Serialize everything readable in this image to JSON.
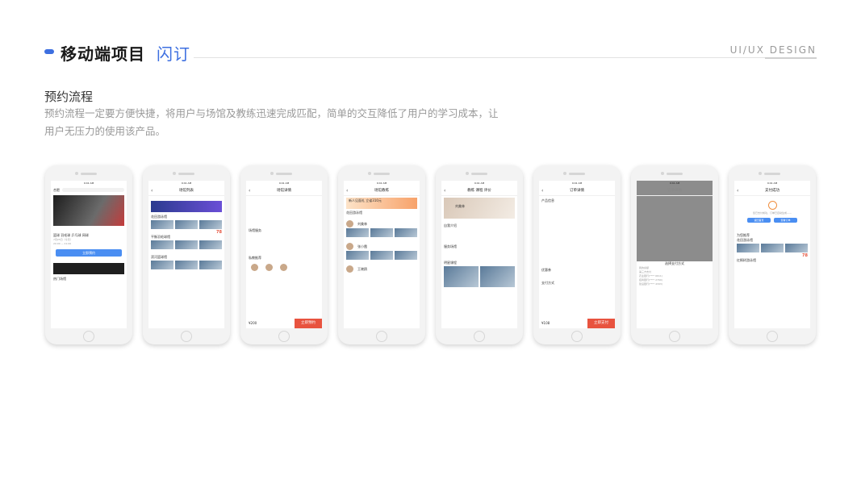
{
  "header": {
    "title": "移动端项目",
    "subtitle": "闪订",
    "brand": "UI/UX DESIGN"
  },
  "section": {
    "title": "预约流程",
    "description": "预约流程一定要方便快捷，将用户与场馆及教练迅速完成匹配，简单的交互降低了用户的学习成本，让用户无压力的使用该产品。"
  },
  "phones": {
    "p1": {
      "time": "9:41 AM",
      "city": "合肥",
      "tabs": "篮球 羽毛球 乒乓球 网球",
      "date": "7月25日（今天）",
      "time_range": "20:00 — 21:00",
      "book": "立即预约",
      "hot": "热门场馆"
    },
    "p2": {
      "nav": "场馆列表",
      "venue1": "花田游泳馆",
      "venue2": "平衡羽毛球馆",
      "venue3": "滨河篮球馆",
      "price": "78"
    },
    "p3": {
      "nav": "场馆详情",
      "service": "场馆服务",
      "coach": "私教推荐",
      "price": "¥200",
      "book": "立即预约"
    },
    "p4": {
      "nav": "场馆教练",
      "banner": "新人见面礼 立省310元",
      "venue": "花田游泳馆",
      "coach1": "刘美林",
      "coach2": "张小霞",
      "coach3": "王晓鸥"
    },
    "p5": {
      "tabs": "教练 课程 评价",
      "coach": "刘美林",
      "intro": "自我介绍",
      "service": "服务场馆",
      "course": "明星课程"
    },
    "p6": {
      "nav": "订单详情",
      "info": "产品信息",
      "coupon": "优惠券",
      "pay": "支付方式",
      "price": "¥108",
      "submit": "立即支付"
    },
    "p7": {
      "nav": "订单详情",
      "sheet": "选择支付方式",
      "opt1": "我的余额",
      "opt2": "第三方支付",
      "opt3": "农业银行(**** 6611)",
      "opt4": "招商银行(**** 2760)",
      "opt5": "建设银行(**** 4393)"
    },
    "p8": {
      "nav": "支付成功",
      "msg": "您已支付成功，订单已自动生成——",
      "btn1": "返回首页",
      "btn2": "查看订单",
      "rec": "为您推荐",
      "venue1": "花田游泳馆",
      "venue2": "红枫树游泳馆",
      "price": "78"
    }
  }
}
